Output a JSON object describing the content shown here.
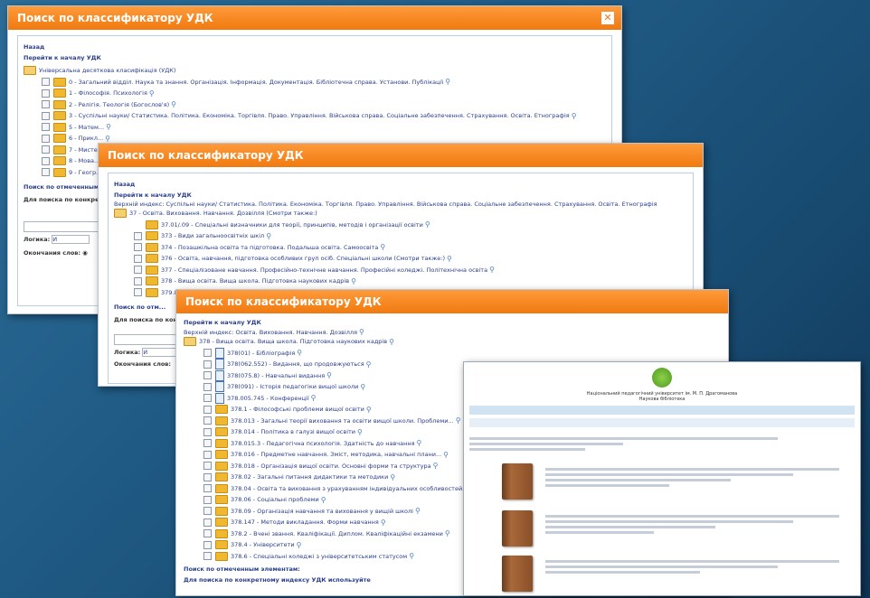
{
  "window1": {
    "title": "Поиск по классификатору УДК",
    "close_label": "✕",
    "back": "Назад",
    "to_start": "Перейти к началу УДК",
    "root": "Універсальна десяткова класифікація (УДК)",
    "items": [
      "0 - Загальний відділ. Наука та знання. Організація. Інформація. Документація. Бібліотечна справа. Установи. Публікації",
      "1 - Філософія. Психологія",
      "2 - Релігія. Теологія (Богослов'я)",
      "3 - Суспільні науки/ Статистика. Політика. Економіка. Торгівля. Право. Управління. Військова справа. Соціальне забезпечення. Страхування. Освіта. Етнографія",
      "5 - Матем...",
      "6 - Прикл...",
      "7 - Мисте...",
      "8 - Мова...",
      "9 - Геогр..."
    ],
    "search_marked": "Поиск по отмеченным...",
    "search_index": "Для поиска по конкре...",
    "logic_label": "Логика:",
    "logic_value": "И",
    "endings_label": "Окончания слов:"
  },
  "window2": {
    "title": "Поиск по классификатору УДК",
    "back": "Назад",
    "to_start": "Перейти к началу УДК",
    "parent": "Верхній индекс: Суспільні науки/ Статистика. Політика. Економіка. Торгівля. Право. Управління. Військова справа. Соціальне забезпечення. Страхування. Освіта. Етнографія",
    "root": "37 - Освіта. Виховання. Навчання. Дозвілля (Смотри также:)",
    "items": [
      "37.01/.09 - Спеціальні визначники для теорії, принципів, методів і організації освіти",
      "373 - Види загальноосвітніх шкіл",
      "374 - Позашкільна освіта та підготовка. Подальша освіта. Самоосвіта",
      "376 - Освіта, навчання, підготовка особливих груп осіб. Спеціальні школи (Смотри также:)",
      "377 - Спеціалізоване навчання. Професійно-технічне навчання. Професійні коледжі. Політехнічна освіта",
      "378 - Вища освіта. Вища школа. Підготовка наукових кадрів",
      "379.8 ..."
    ],
    "search_marked": "Поиск по отм...",
    "search_index": "Для поиска по конк...",
    "logic_label": "Логика:",
    "logic_value": "И",
    "endings_label": "Окончания слов:"
  },
  "window3": {
    "title": "Поиск по классификатору УДК",
    "to_start": "Перейти к началу УДК",
    "parent": "Верхній индекс: Освіта. Виховання. Навчання. Дозвілля",
    "root": "378 - Вища освіта. Вища школа. Підготовка наукових кадрів",
    "items": [
      {
        "t": "378(01) - Бібліографія",
        "doc": true
      },
      {
        "t": "378(062.552) - Видання, що продовжуються",
        "doc": true
      },
      {
        "t": "378(075.8) - Навчальні видання",
        "doc": true
      },
      {
        "t": "378(091) - Історія педагогіки вищої школи",
        "doc": true
      },
      {
        "t": "378.005.745 - Конференції",
        "doc": true
      },
      {
        "t": "378.1 - Філософські проблеми вищої освіти",
        "doc": false
      },
      {
        "t": "378.013 - Загальні теорії виховання та освіти вищої школи. Проблеми...",
        "doc": false
      },
      {
        "t": "378.014 - Політика в галузі вищої освіти",
        "doc": false
      },
      {
        "t": "378.015.3 - Педагогічна психологія. Здатність до навчання",
        "doc": false
      },
      {
        "t": "378.016 - Предметне навчання. Зміст, методика, навчальні плани...",
        "doc": false
      },
      {
        "t": "378.018 - Організація вищої освіти. Основні форми та структура",
        "doc": false
      },
      {
        "t": "378.02 - Загальні питання дидактики та методики",
        "doc": false
      },
      {
        "t": "378.04 - Освіта та виховання з урахуванням індивідуальних особливостей...",
        "doc": false
      },
      {
        "t": "378.06 - Соціальні проблеми",
        "doc": false
      },
      {
        "t": "378.09 - Організація навчання та виховання у вищій школі",
        "doc": false
      },
      {
        "t": "378.147 - Методи викладання. Форми навчання",
        "doc": false
      },
      {
        "t": "378.2 - Вчені звання. Кваліфікації. Диплом. Кваліфікаційні екзамени",
        "doc": false
      },
      {
        "t": "378.4 - Університети",
        "doc": false
      },
      {
        "t": "378.6 - Спеціальні коледжі з університетським статусом",
        "doc": false
      }
    ],
    "search_marked": "Поиск по отмеченным элементам:",
    "search_index": "Для поиска по конкретному индексу УДК используйте"
  },
  "library": {
    "header": "Національний педагогічний університет ім. М. П. Драгоманова",
    "subheader": "Наукова бібліотека"
  }
}
